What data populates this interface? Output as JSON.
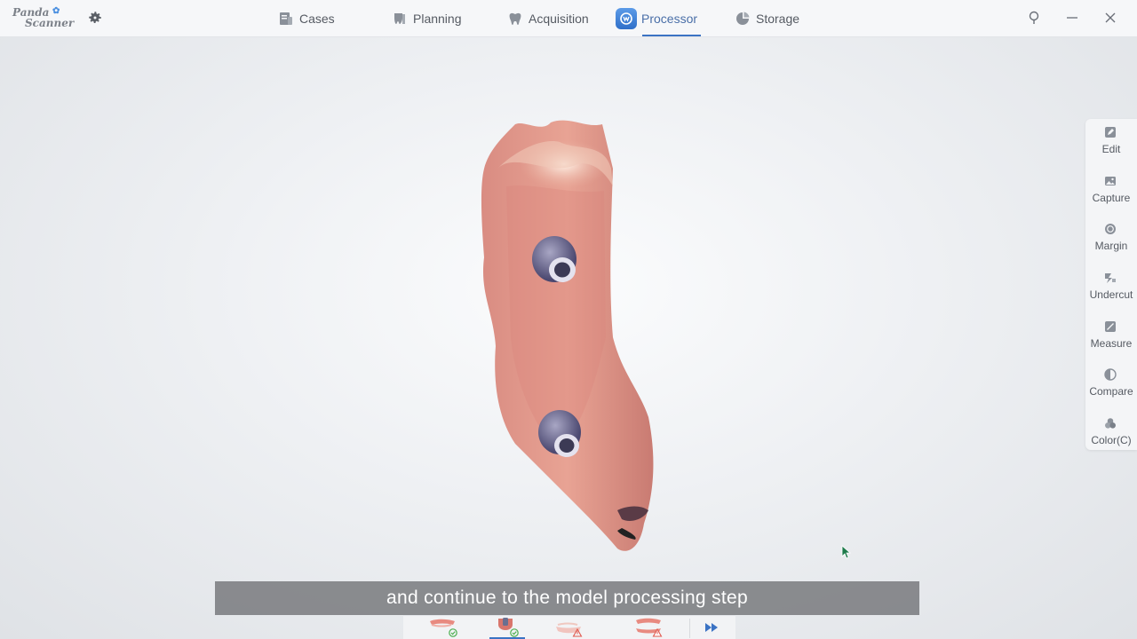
{
  "app": {
    "logo_line1": "Panda",
    "logo_line2": "Scanner",
    "logo_paw_icon": "paw-icon",
    "settings_icon": "gear-icon"
  },
  "nav": {
    "items": [
      {
        "label": "Cases",
        "icon": "cases-icon"
      },
      {
        "label": "Planning",
        "icon": "tooth-plan-icon"
      },
      {
        "label": "Acquisition",
        "icon": "tooth-scan-icon"
      },
      {
        "label": "Processor",
        "icon": "processor-icon",
        "active": true
      },
      {
        "label": "Storage",
        "icon": "pie-chart-icon"
      }
    ]
  },
  "window_controls": [
    "pin-icon",
    "minimize-icon",
    "close-icon"
  ],
  "tools": [
    {
      "label": "Edit",
      "icon": "edit-icon"
    },
    {
      "label": "Capture",
      "icon": "image-icon"
    },
    {
      "label": "Margin",
      "icon": "margin-icon"
    },
    {
      "label": "Undercut",
      "icon": "undercut-icon"
    },
    {
      "label": "Measure",
      "icon": "measure-icon"
    },
    {
      "label": "Compare",
      "icon": "compare-icon"
    },
    {
      "label": "Color(C)",
      "icon": "color-icon"
    }
  ],
  "subtitle": "and continue to the model processing step",
  "steps": [
    {
      "name": "upper-jaw",
      "status": "done"
    },
    {
      "name": "scan-body",
      "status": "done",
      "active": true
    },
    {
      "name": "lower-jaw",
      "status": "warning"
    },
    {
      "name": "bite",
      "status": "warning"
    },
    {
      "name": "next",
      "icon": "fast-forward-icon"
    }
  ],
  "colors": {
    "accent": "#3b73c4",
    "ok": "#4caf50",
    "warning": "#e05a4f"
  }
}
